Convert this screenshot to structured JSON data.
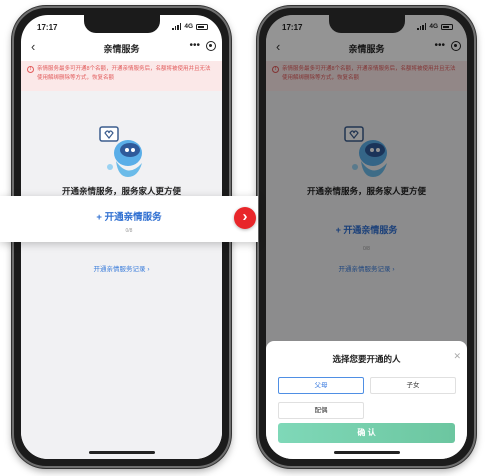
{
  "status": {
    "time": "17:17",
    "network": "4G"
  },
  "navbar": {
    "title": "亲情服务"
  },
  "notice": {
    "text": "亲情服务最多可开通8个名额，开通亲情服务后，名额将被使用并且无法使用解绑删除等方式，恢复名额"
  },
  "main": {
    "headline": "开通亲情服务，服务家人更方便",
    "open_button": "开通亲情服务",
    "count": "0/8",
    "records_link": "开通亲情服务记录"
  },
  "sheet": {
    "title": "选择您要开通的人",
    "options": [
      "父母",
      "子女",
      "配偶"
    ],
    "confirm": "确 认"
  },
  "colors": {
    "accent": "#2f6fd1",
    "warning": "#e25b5b",
    "arrow": "#e8262a",
    "confirm": "#6cc6a0"
  }
}
